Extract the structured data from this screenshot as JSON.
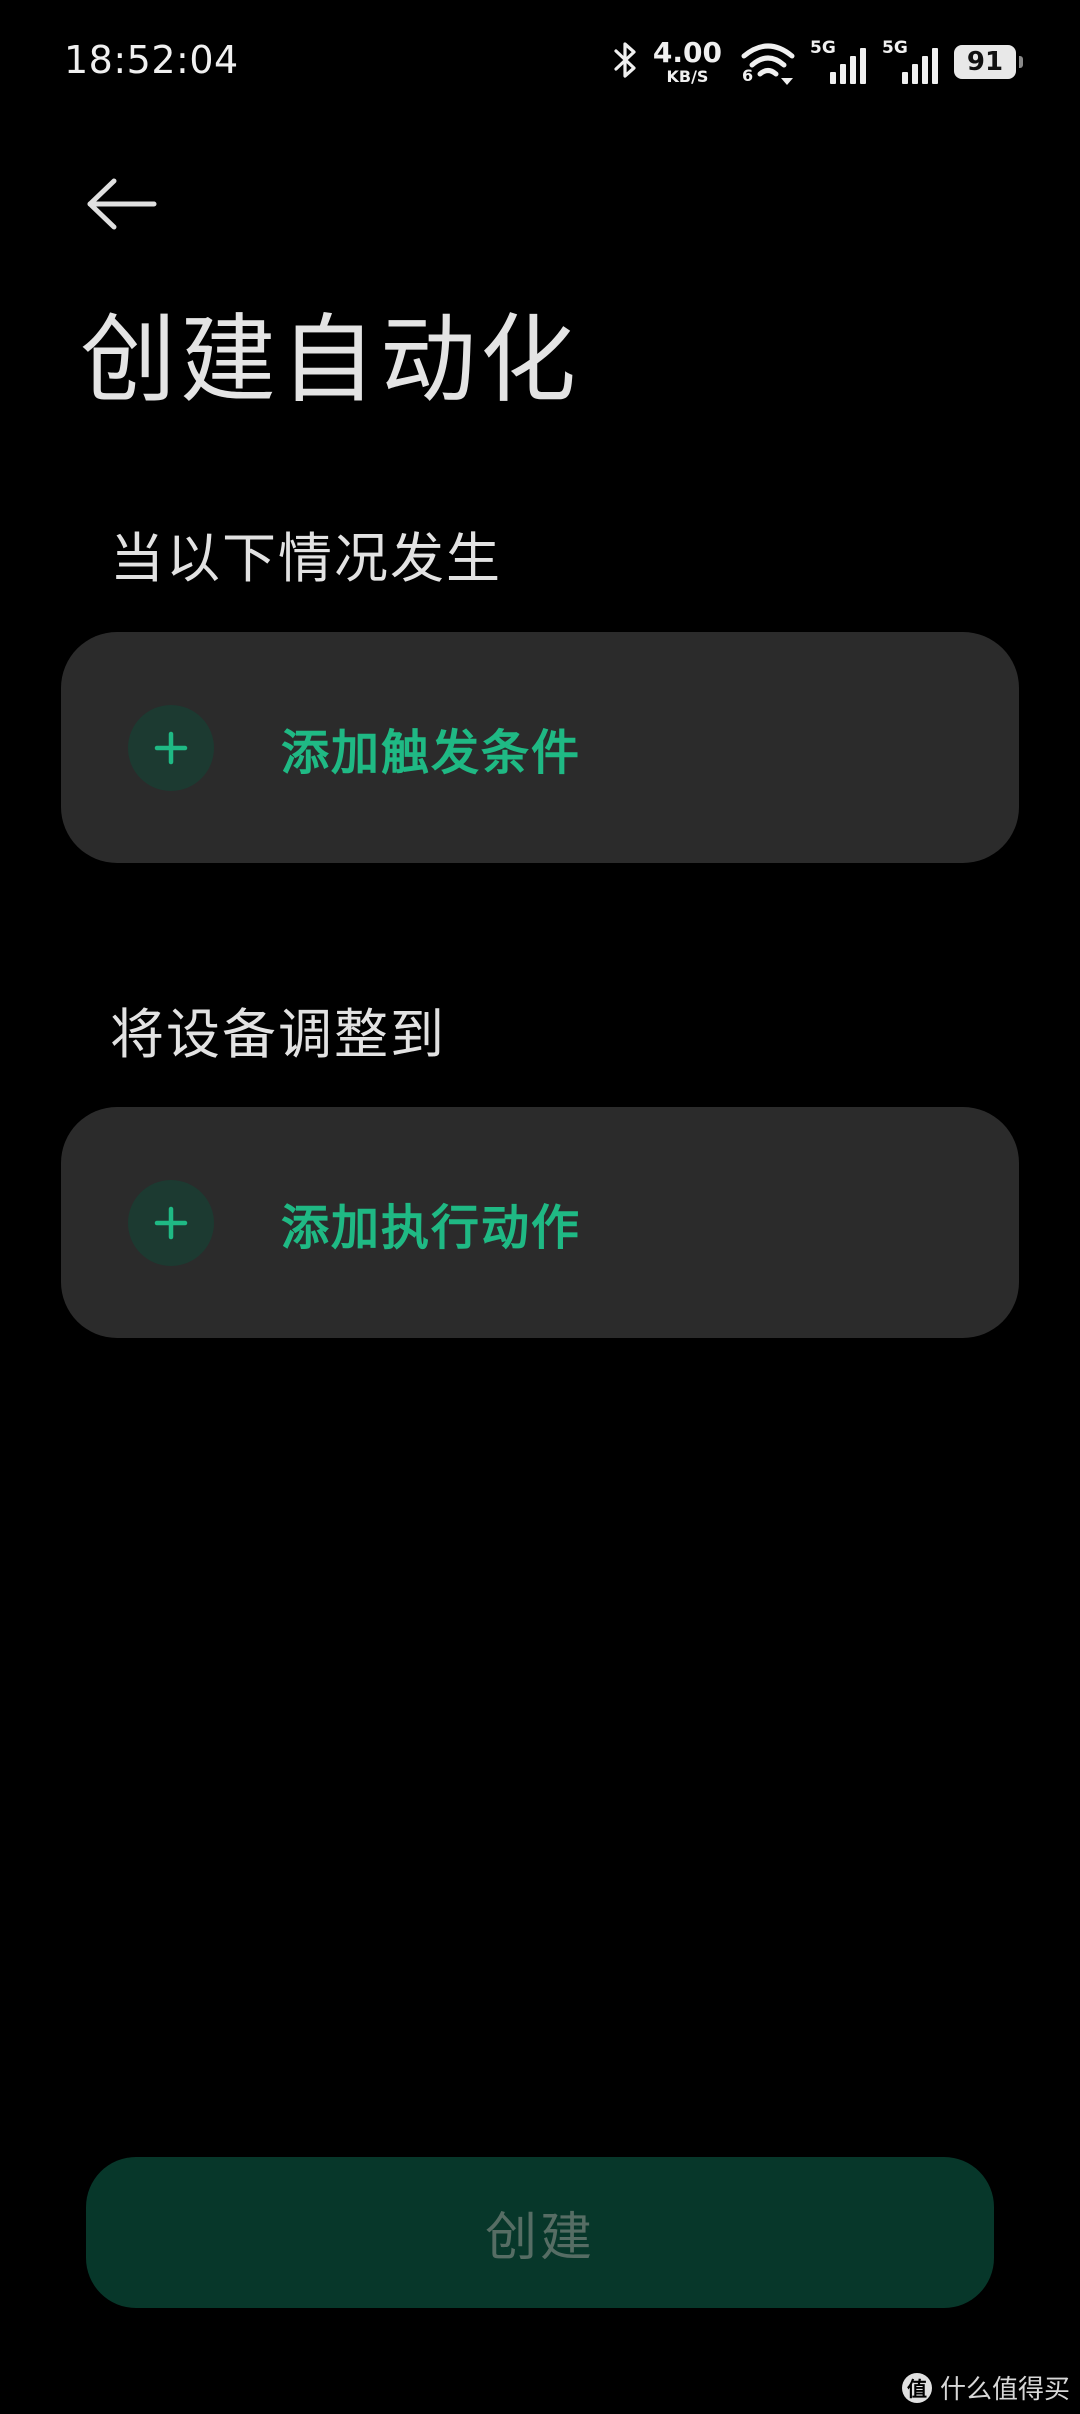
{
  "status_bar": {
    "time": "18:52:04",
    "net_speed_value": "4.00",
    "net_speed_unit": "KB/S",
    "wifi_label": "6",
    "signal1_label": "5G",
    "signal2_label": "5G",
    "battery_level": "91",
    "icons": [
      "bluetooth-icon",
      "wifi-icon",
      "cellular-signal-icon",
      "battery-icon"
    ]
  },
  "header": {
    "back_icon": "arrow-left-icon",
    "title": "创建自动化"
  },
  "trigger_section": {
    "label": "当以下情况发生",
    "add_label": "添加触发条件",
    "icon": "plus-icon"
  },
  "action_section": {
    "label": "将设备调整到",
    "add_label": "添加执行动作",
    "icon": "plus-icon"
  },
  "footer": {
    "create_label": "创建"
  },
  "watermark": {
    "badge": "值",
    "text": "什么值得买"
  },
  "colors": {
    "background": "#000000",
    "card": "#2b2b2b",
    "accent_green": "#1fb984",
    "plus_circle": "#1c3a31",
    "create_button": "#07372a",
    "create_text_disabled": "#566d64"
  }
}
